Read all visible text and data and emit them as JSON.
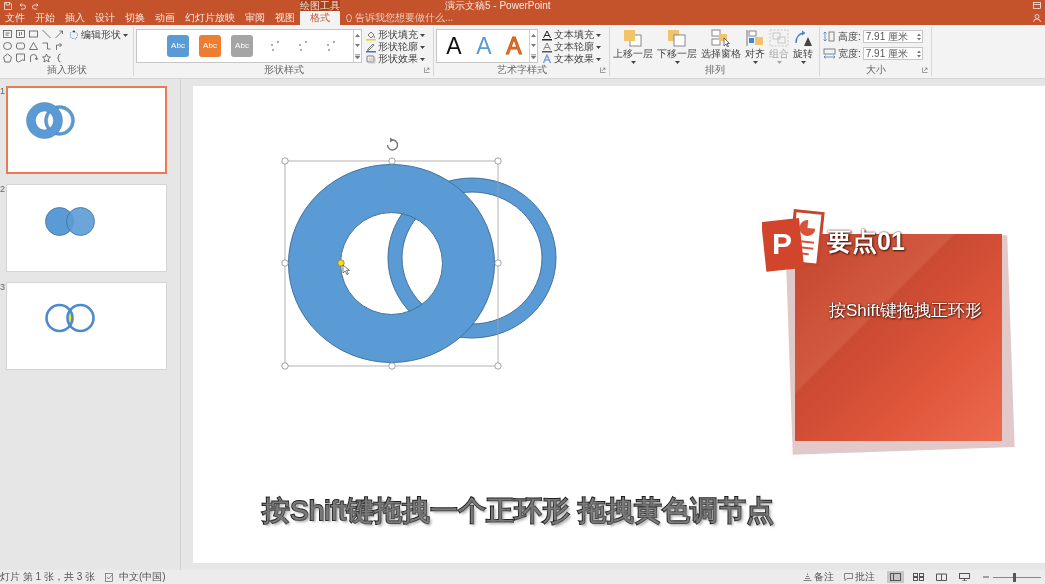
{
  "window": {
    "title": "演示文稿5 - PowerPoint",
    "context_tab": "绘图工具"
  },
  "tabs": [
    {
      "label": "文件",
      "selected": false
    },
    {
      "label": "开始",
      "selected": false
    },
    {
      "label": "插入",
      "selected": false
    },
    {
      "label": "设计",
      "selected": false
    },
    {
      "label": "切换",
      "selected": false
    },
    {
      "label": "动画",
      "selected": false
    },
    {
      "label": "幻灯片放映",
      "selected": false
    },
    {
      "label": "审阅",
      "selected": false
    },
    {
      "label": "视图",
      "selected": false
    },
    {
      "label": "格式",
      "selected": true
    }
  ],
  "tell_me": {
    "placeholder": "告诉我您想要做什么..."
  },
  "ribbon": {
    "insert_shapes": {
      "label": "插入形状",
      "edit_shape": "编辑形状"
    },
    "shape_styles": {
      "label": "形状样式",
      "swatches": [
        {
          "text": "Abc",
          "color": "#5b9bd5"
        },
        {
          "text": "Abc",
          "color": "#ed7d31"
        },
        {
          "text": "Abc",
          "color": "#a5a5a5"
        }
      ],
      "commands": [
        "形状填充",
        "形状轮廓",
        "形状效果"
      ]
    },
    "wordart_styles": {
      "label": "艺术字样式",
      "samples": [
        {
          "text": "A",
          "kind": "fill",
          "color": "#111111"
        },
        {
          "text": "A",
          "kind": "fill",
          "color": "#5b9bd5"
        },
        {
          "text": "A",
          "kind": "outline",
          "color": "#ed7d31"
        }
      ],
      "commands": [
        "文本填充",
        "文本轮廓",
        "文本效果"
      ]
    },
    "arrange": {
      "label": "排列",
      "buttons": [
        {
          "kind": "bring_forward",
          "label": "上移一层",
          "disabled": false,
          "dropdown": true
        },
        {
          "kind": "send_backward",
          "label": "下移一层",
          "disabled": false,
          "dropdown": true
        },
        {
          "kind": "selection_pane",
          "label": "选择窗格",
          "disabled": false,
          "dropdown": false
        },
        {
          "kind": "align",
          "label": "对齐",
          "disabled": false,
          "dropdown": true
        },
        {
          "kind": "group",
          "label": "组合",
          "disabled": true,
          "dropdown": true
        },
        {
          "kind": "rotate",
          "label": "旋转",
          "disabled": false,
          "dropdown": true
        }
      ]
    },
    "size": {
      "label": "大小",
      "fields": [
        {
          "kind": "height",
          "label": "高度:",
          "value": "7.91 厘米"
        },
        {
          "kind": "width",
          "label": "宽度:",
          "value": "7.91 厘米"
        }
      ]
    }
  },
  "slides": [
    {
      "number": "1",
      "kind": "ring_pair",
      "selected": true
    },
    {
      "number": "2",
      "kind": "disc_pair",
      "selected": false
    },
    {
      "number": "3",
      "kind": "linked_rings",
      "selected": false
    }
  ],
  "slide": {
    "tip_card": {
      "logo_letter": "P",
      "heading": "要点01",
      "text": "按Shift键拖拽正环形"
    },
    "caption": "按Shift键拖拽一个正环形 拖拽黄色调节点"
  },
  "status_bar": {
    "slide_info": "灯片 第 1 张，共 3 张",
    "language": "中文(中国)",
    "notes": "备注",
    "comments": "批注",
    "views": [
      {
        "kind": "normal",
        "selected": true
      },
      {
        "kind": "sorter",
        "selected": false
      },
      {
        "kind": "reading",
        "selected": false
      },
      {
        "kind": "slideshow",
        "selected": false
      }
    ],
    "zoom": {
      "level": 0.45
    }
  }
}
